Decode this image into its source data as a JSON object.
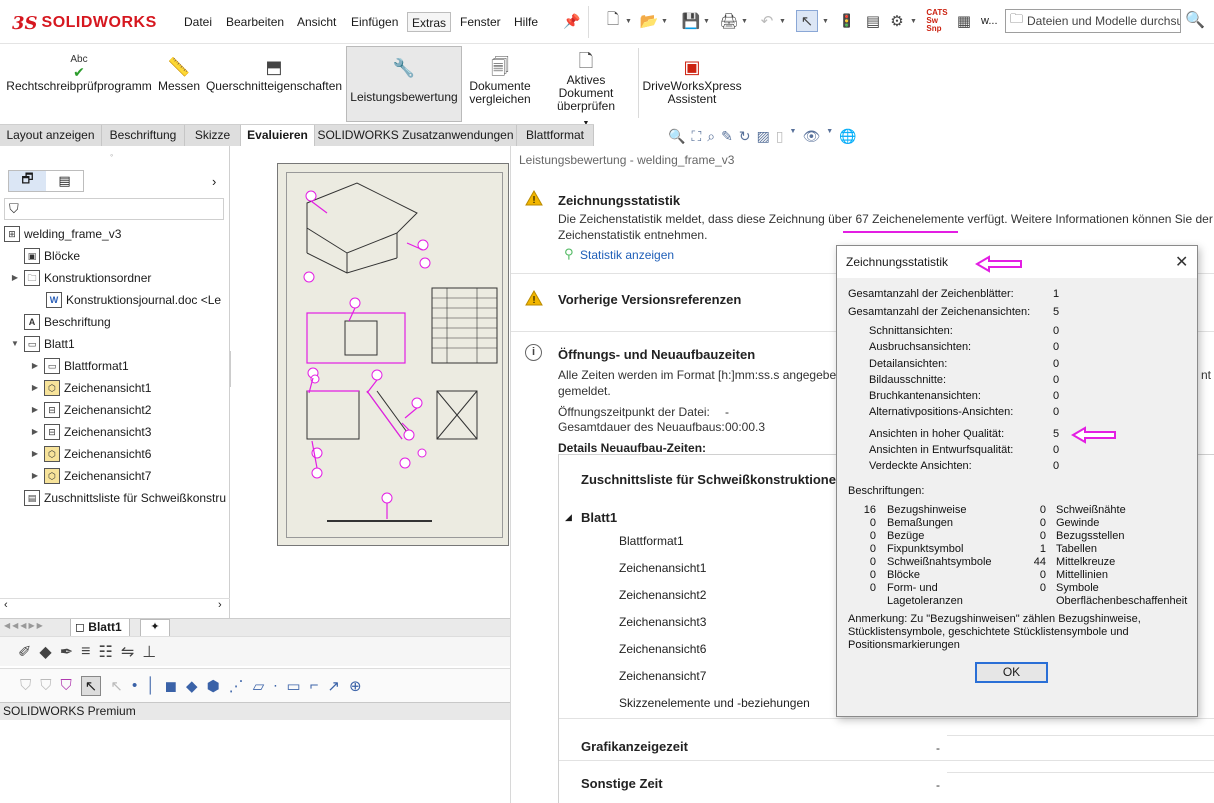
{
  "app": {
    "logo_brand": "SOLIDWORKS",
    "menus": [
      "Datei",
      "Bearbeiten",
      "Ansicht",
      "Einfügen",
      "Extras",
      "Fenster",
      "Hilfe"
    ],
    "active_menu": "Extras",
    "search_placeholder": "Dateien und Modelle durchsu",
    "toolbar_w_label": "w..."
  },
  "ribbon": {
    "buttons": [
      {
        "label": "Rechtschreibprüfprogramm",
        "icon": "spellcheck-icon",
        "sub": "Abc"
      },
      {
        "label": "Messen",
        "icon": "measure-icon"
      },
      {
        "label": "Querschnitteigenschaften",
        "icon": "section-properties-icon"
      },
      {
        "label": "Leistungsbewertung",
        "icon": "performance-evaluation-icon"
      },
      {
        "label": "Dokumente vergleichen",
        "icon": "compare-documents-icon"
      },
      {
        "label": "Aktives Dokument überprüfen",
        "icon": "check-document-icon"
      },
      {
        "label": "DriveWorksXpress Assistent",
        "icon": "driveworks-icon"
      }
    ]
  },
  "tabs": [
    "Layout anzeigen",
    "Beschriftung",
    "Skizze",
    "Evaluieren",
    "SOLIDWORKS Zusatzanwendungen",
    "Blattformat"
  ],
  "active_tab": "Evaluieren",
  "tree": {
    "root": "welding_frame_v3",
    "items": [
      {
        "label": "Blöcke",
        "level": 1
      },
      {
        "label": "Konstruktionsordner",
        "level": 1
      },
      {
        "label": "Konstruktionsjournal.doc <Le",
        "level": 2
      },
      {
        "label": "Beschriftung",
        "level": 1
      },
      {
        "label": "Blatt1",
        "level": 1
      },
      {
        "label": "Blattformat1",
        "level": 2
      },
      {
        "label": "Zeichenansicht1",
        "level": 2
      },
      {
        "label": "Zeichenansicht2",
        "level": 2
      },
      {
        "label": "Zeichenansicht3",
        "level": 2
      },
      {
        "label": "Zeichenansicht6",
        "level": 2
      },
      {
        "label": "Zeichenansicht7",
        "level": 2
      },
      {
        "label": "Zuschnittsliste für Schweißkonstru",
        "level": 1
      }
    ]
  },
  "sheet_tab": "Blatt1",
  "status": "SOLIDWORKS Premium",
  "report": {
    "title": "Leistungsbewertung - welding_frame_v3",
    "section1_head": "Zeichnungsstatistik",
    "section1_text": "Die Zeichenstatistik meldet, dass diese Zeichnung über 67 Zeichenelemente verfügt. Weitere Informationen können Sie der Zeichenstatistik entnehmen.",
    "section1_link": "Statistik anzeigen",
    "section2_head": "Vorherige Versionsreferenzen",
    "section3_head": "Öffnungs- und Neuaufbauzeiten",
    "section3_text_a": "Alle Zeiten werden im Format [h:]mm:ss.s angegeben",
    "section3_text_a_tail": "nt",
    "section3_text_b": "gemeldet.",
    "open_time_label": "Öffnungszeitpunkt der Datei:",
    "open_time_value": "-",
    "rebuild_label": "Gesamtdauer des Neuaufbaus:",
    "rebuild_value": "00:00.3",
    "details_label": "Details Neuaufbau-Zeiten:",
    "detail_rows": [
      {
        "label": "Zuschnittsliste für Schweißkonstruktionen",
        "bold": true
      },
      {
        "label": "Blatt1",
        "bold": true
      },
      {
        "label": "Blattformat1"
      },
      {
        "label": "Zeichenansicht1"
      },
      {
        "label": "Zeichenansicht2"
      },
      {
        "label": "Zeichenansicht3"
      },
      {
        "label": "Zeichenansicht6"
      },
      {
        "label": "Zeichenansicht7"
      },
      {
        "label": "Skizzenelemente und -beziehungen"
      },
      {
        "label": "Grafikanzeigezeit",
        "bold": true,
        "value": "-"
      },
      {
        "label": "Sonstige Zeit",
        "bold": true,
        "value": "-"
      }
    ]
  },
  "dialog": {
    "title": "Zeichnungsstatistik",
    "ok": "OK",
    "stats": [
      {
        "label": "Gesamtanzahl der Zeichenblätter:",
        "value": "1"
      },
      {
        "label": "Gesamtanzahl der Zeichenansichten:",
        "value": "5"
      },
      {
        "label": "Schnittansichten:",
        "value": "0"
      },
      {
        "label": "Ausbruchsansichten:",
        "value": "0"
      },
      {
        "label": "Detailansichten:",
        "value": "0"
      },
      {
        "label": "Bildausschnitte:",
        "value": "0"
      },
      {
        "label": "Bruchkantenansichten:",
        "value": "0"
      },
      {
        "label": "Alternativpositions-Ansichten:",
        "value": "0"
      },
      {
        "label": "Ansichten in hoher Qualität:",
        "value": "5"
      },
      {
        "label": "Ansichten in Entwurfsqualität:",
        "value": "0"
      },
      {
        "label": "Verdeckte Ansichten:",
        "value": "0"
      }
    ],
    "annot_head": "Beschriftungen:",
    "annotations_left": [
      {
        "n": "16",
        "label": "Bezugshinweise"
      },
      {
        "n": "0",
        "label": "Bemaßungen"
      },
      {
        "n": "0",
        "label": "Bezüge"
      },
      {
        "n": "0",
        "label": "Fixpunktsymbol"
      },
      {
        "n": "0",
        "label": "Schweißnahtsymbole"
      },
      {
        "n": "0",
        "label": "Blöcke"
      },
      {
        "n": "0",
        "label": "Form- und"
      }
    ],
    "annotations_left_extra": "Lagetoleranzen",
    "annotations_right": [
      {
        "n": "0",
        "label": "Schweißnähte"
      },
      {
        "n": "0",
        "label": "Gewinde"
      },
      {
        "n": "0",
        "label": "Bezugsstellen"
      },
      {
        "n": "1",
        "label": "Tabellen"
      },
      {
        "n": "44",
        "label": "Mittelkreuze"
      },
      {
        "n": "0",
        "label": "Mittellinien"
      },
      {
        "n": "0",
        "label": "Symbole"
      }
    ],
    "annotations_right_extra": "Oberflächenbeschaffenheit",
    "note": "Anmerkung: Zu \"Bezugshinweisen\" zählen Bezugshinweise, Stücklistensymbole, geschichtete Stücklistensymbole und Positionsmarkierungen"
  },
  "colors": {
    "brand": "#d6171f",
    "highlight": "#e31ee3",
    "warning": "#f2b600",
    "link": "#1f5fb8"
  }
}
